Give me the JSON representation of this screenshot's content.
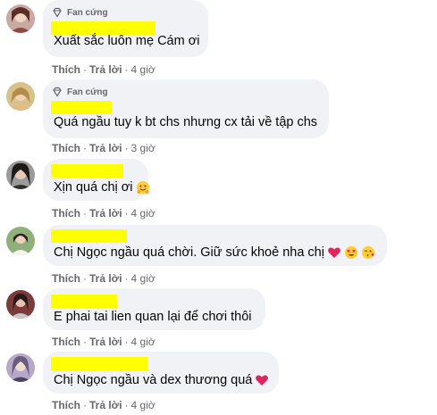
{
  "badge_label": "Fan cứng",
  "reply_label": "Trả lời",
  "like_label": "Thích",
  "separator": "·",
  "comments": [
    {
      "has_badge": true,
      "text": "Xuất sắc luôn mẹ Cám ơi",
      "time": "4 giờ",
      "emojis": []
    },
    {
      "has_badge": true,
      "text": "Quá ngầu tuy k bt chs nhưng cx tải về tập chs",
      "time": "3 giờ",
      "emojis": []
    },
    {
      "has_badge": false,
      "text": "Xịn quá chị ơi",
      "time": "4 giờ",
      "emojis": [
        "hugging-face-emoji"
      ]
    },
    {
      "has_badge": false,
      "text": "Chị Ngọc ngầu quá chời. Giữ sức khoẻ nha chị",
      "time": "4 giờ",
      "emojis": [
        "red-heart-emoji",
        "heart-eyes-emoji",
        "blowing-kiss-emoji"
      ]
    },
    {
      "has_badge": false,
      "text": "E phai tai lien quan lại để chơi thôi",
      "time": "4 giờ",
      "emojis": []
    },
    {
      "has_badge": false,
      "text": "Chị Ngọc ngầu và dex thương quá",
      "time": "4 giờ",
      "emojis": [
        "red-heart-emoji"
      ]
    }
  ],
  "colors": {
    "bubble": "#f0f2f5",
    "redaction": "#ffff00",
    "meta_text": "#65676b",
    "body_text": "#050505"
  }
}
